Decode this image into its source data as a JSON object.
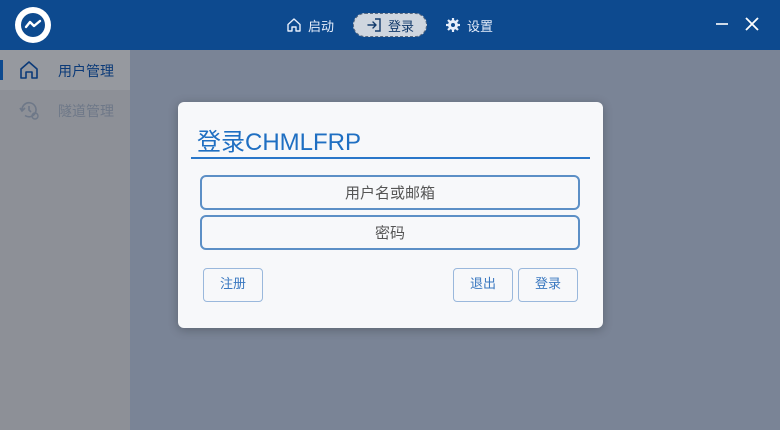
{
  "nav": {
    "launch_label": "启动",
    "login_label": "登录",
    "settings_label": "设置"
  },
  "sidebar": {
    "items": [
      {
        "label": "用户管理",
        "icon": "home-icon",
        "active": true
      },
      {
        "label": "隧道管理",
        "icon": "history-settings-icon",
        "active": false
      }
    ]
  },
  "dialog": {
    "title": "登录CHMLFRP",
    "username_placeholder": "用户名或邮箱",
    "password_placeholder": "密码",
    "register_label": "注册",
    "exit_label": "退出",
    "login_label": "登录"
  },
  "colors": {
    "titlebar": "#0d4a8f",
    "accent": "#1f6fc2",
    "overlay": "#7a8496"
  }
}
